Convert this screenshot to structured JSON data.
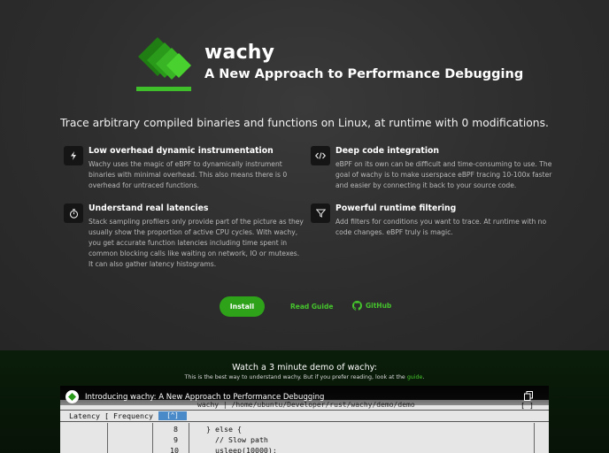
{
  "brand": {
    "name": "wachy",
    "tagline": "A New Approach to Performance Debugging"
  },
  "lead": "Trace arbitrary compiled binaries and functions on Linux, at runtime with 0 modifications.",
  "features": [
    {
      "icon": "lightning-icon",
      "title": "Low overhead dynamic instrumentation",
      "desc": "Wachy uses the magic of eBPF to dynamically instrument binaries with minimal overhead. This also means there is 0 overhead for untraced functions."
    },
    {
      "icon": "code-icon",
      "title": "Deep code integration",
      "desc": "eBPF on its own can be difficult and time-consuming to use. The goal of wachy is to make userspace eBPF tracing 10-100x faster and easier by connecting it back to your source code."
    },
    {
      "icon": "stopwatch-icon",
      "title": "Understand real latencies",
      "desc": "Stack sampling profilers only provide part of the picture as they usually show the proportion of active CPU cycles. With wachy, you get accurate function latencies including time spent in common blocking calls like waiting on network, IO or mutexes. It can also gather latency histograms."
    },
    {
      "icon": "filter-icon",
      "title": "Powerful runtime filtering",
      "desc": "Add filters for conditions you want to trace. At runtime with no code changes. eBPF truly is magic."
    }
  ],
  "actions": {
    "install": "Install",
    "read_guide": "Read Guide",
    "github": "GitHub"
  },
  "demo": {
    "title": "Watch a 3 minute demo of wachy:",
    "subtitle_prefix": "This is the best way to understand wachy. But if you prefer reading, look at the ",
    "subtitle_link": "guide",
    "subtitle_suffix": ".",
    "video_title": "Introducing wachy: A New Approach to Performance Debugging",
    "terminal": {
      "tab": "wachy | /home/ubuntu/Developer/rust/wachy/demo/demo",
      "columns": [
        "Latency [",
        "Frequency [",
        "[^]"
      ],
      "rows": [
        {
          "line": "8",
          "code": "} else {"
        },
        {
          "line": "9",
          "code": "  // Slow path"
        },
        {
          "line": "10",
          "code": "  usleep(10000);"
        }
      ],
      "bracket": "[ ]"
    }
  },
  "colors": {
    "accent": "#2ea31a",
    "link": "#45c52c",
    "logo_green": "#3fbf2a"
  }
}
